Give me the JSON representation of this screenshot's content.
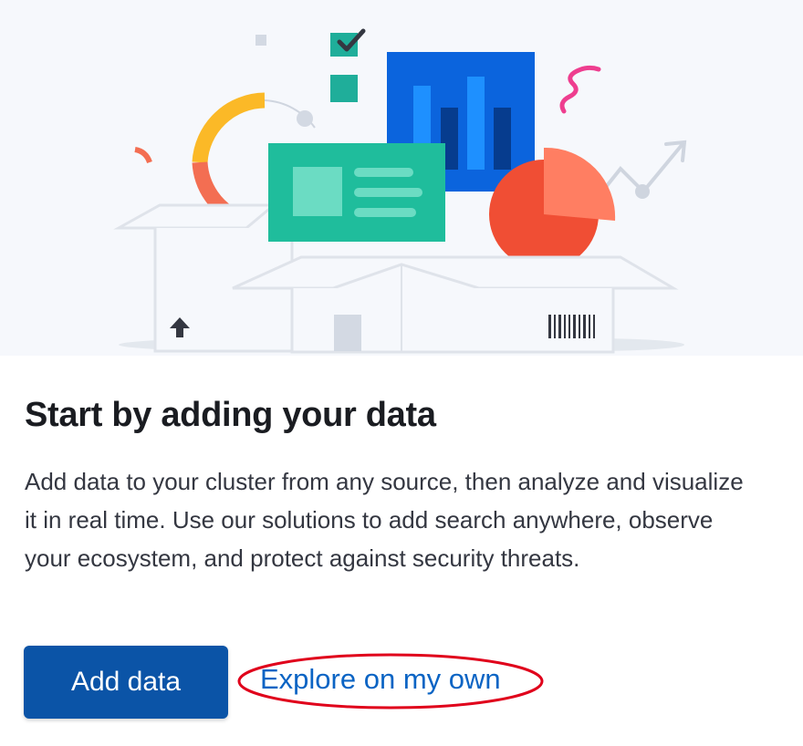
{
  "card": {
    "title": "Start by adding your data",
    "description": "Add data to your cluster from any source, then analyze and visualize it in real time. Use our solutions to add search anywhere, observe your ecosystem, and protect against security threats.",
    "primary_button_label": "Add data",
    "secondary_link_label": "Explore on my own"
  },
  "illustration": {
    "icons": [
      "box-icon",
      "bar-chart-icon",
      "pie-chart-icon",
      "donut-chart-icon",
      "checklist-icon",
      "card-icon",
      "trend-arrow-icon",
      "barcode-icon",
      "up-arrow-icon"
    ]
  },
  "annotation": {
    "highlight_color": "#e0001b"
  }
}
